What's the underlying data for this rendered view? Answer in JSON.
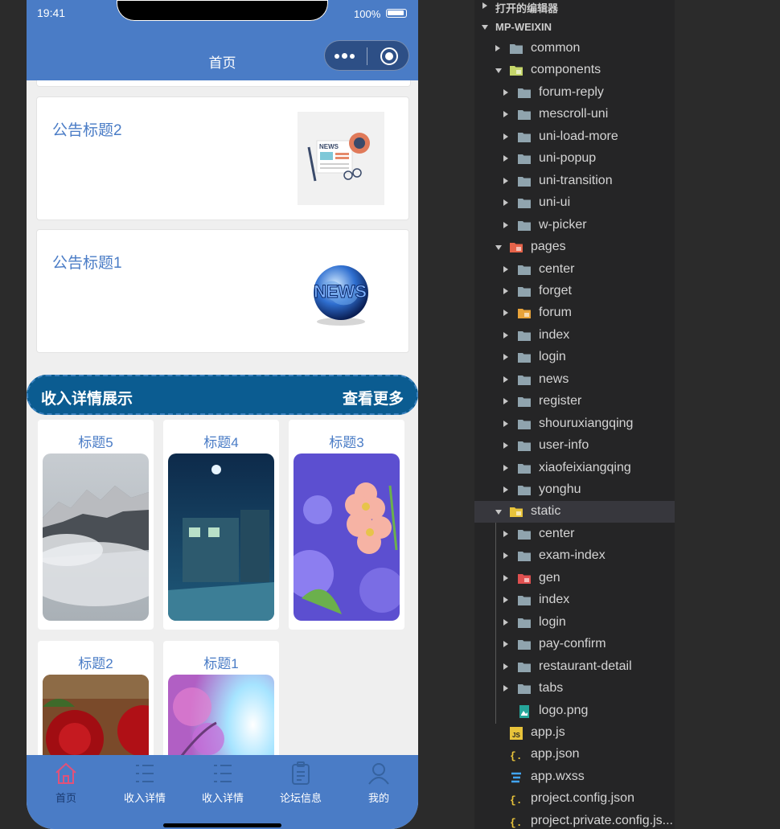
{
  "status_bar": {
    "time": "19:41",
    "battery": "100%"
  },
  "nav_bar": {
    "title": "首页"
  },
  "notices": [
    {
      "title": "公告标题2"
    },
    {
      "title": "公告标题1"
    }
  ],
  "section": {
    "title": "收入详情展示",
    "more": "查看更多"
  },
  "gallery": [
    {
      "title": "标题5"
    },
    {
      "title": "标题4"
    },
    {
      "title": "标题3"
    },
    {
      "title": "标题2"
    },
    {
      "title": "标题1"
    }
  ],
  "tab_bar": [
    {
      "label": "首页",
      "icon": "home-icon",
      "active": true
    },
    {
      "label": "收入详情",
      "icon": "list-icon"
    },
    {
      "label": "收入详情",
      "icon": "list-icon"
    },
    {
      "label": "论坛信息",
      "icon": "clipboard-icon"
    },
    {
      "label": "我的",
      "icon": "user-icon"
    }
  ],
  "explorer": {
    "open_editors": "打开的编辑器",
    "project": "MP-WEIXIN",
    "items": [
      {
        "label": "common"
      },
      {
        "label": "components"
      },
      {
        "label": "forum-reply"
      },
      {
        "label": "mescroll-uni"
      },
      {
        "label": "uni-load-more"
      },
      {
        "label": "uni-popup"
      },
      {
        "label": "uni-transition"
      },
      {
        "label": "uni-ui"
      },
      {
        "label": "w-picker"
      },
      {
        "label": "pages"
      },
      {
        "label": "center"
      },
      {
        "label": "forget"
      },
      {
        "label": "forum"
      },
      {
        "label": "index"
      },
      {
        "label": "login"
      },
      {
        "label": "news"
      },
      {
        "label": "register"
      },
      {
        "label": "shouruxiangqing"
      },
      {
        "label": "user-info"
      },
      {
        "label": "xiaofeixiangqing"
      },
      {
        "label": "yonghu"
      },
      {
        "label": "static"
      },
      {
        "label": "center"
      },
      {
        "label": "exam-index"
      },
      {
        "label": "gen"
      },
      {
        "label": "index"
      },
      {
        "label": "login"
      },
      {
        "label": "pay-confirm"
      },
      {
        "label": "restaurant-detail"
      },
      {
        "label": "tabs"
      },
      {
        "label": "logo.png"
      },
      {
        "label": "app.js"
      },
      {
        "label": "app.json"
      },
      {
        "label": "app.wxss"
      },
      {
        "label": "project.config.json"
      },
      {
        "label": "project.private.config.js..."
      }
    ]
  },
  "colors": {
    "brand": "#4a7cc6",
    "section": "#0b5c91",
    "explorer_bg": "#252526"
  }
}
